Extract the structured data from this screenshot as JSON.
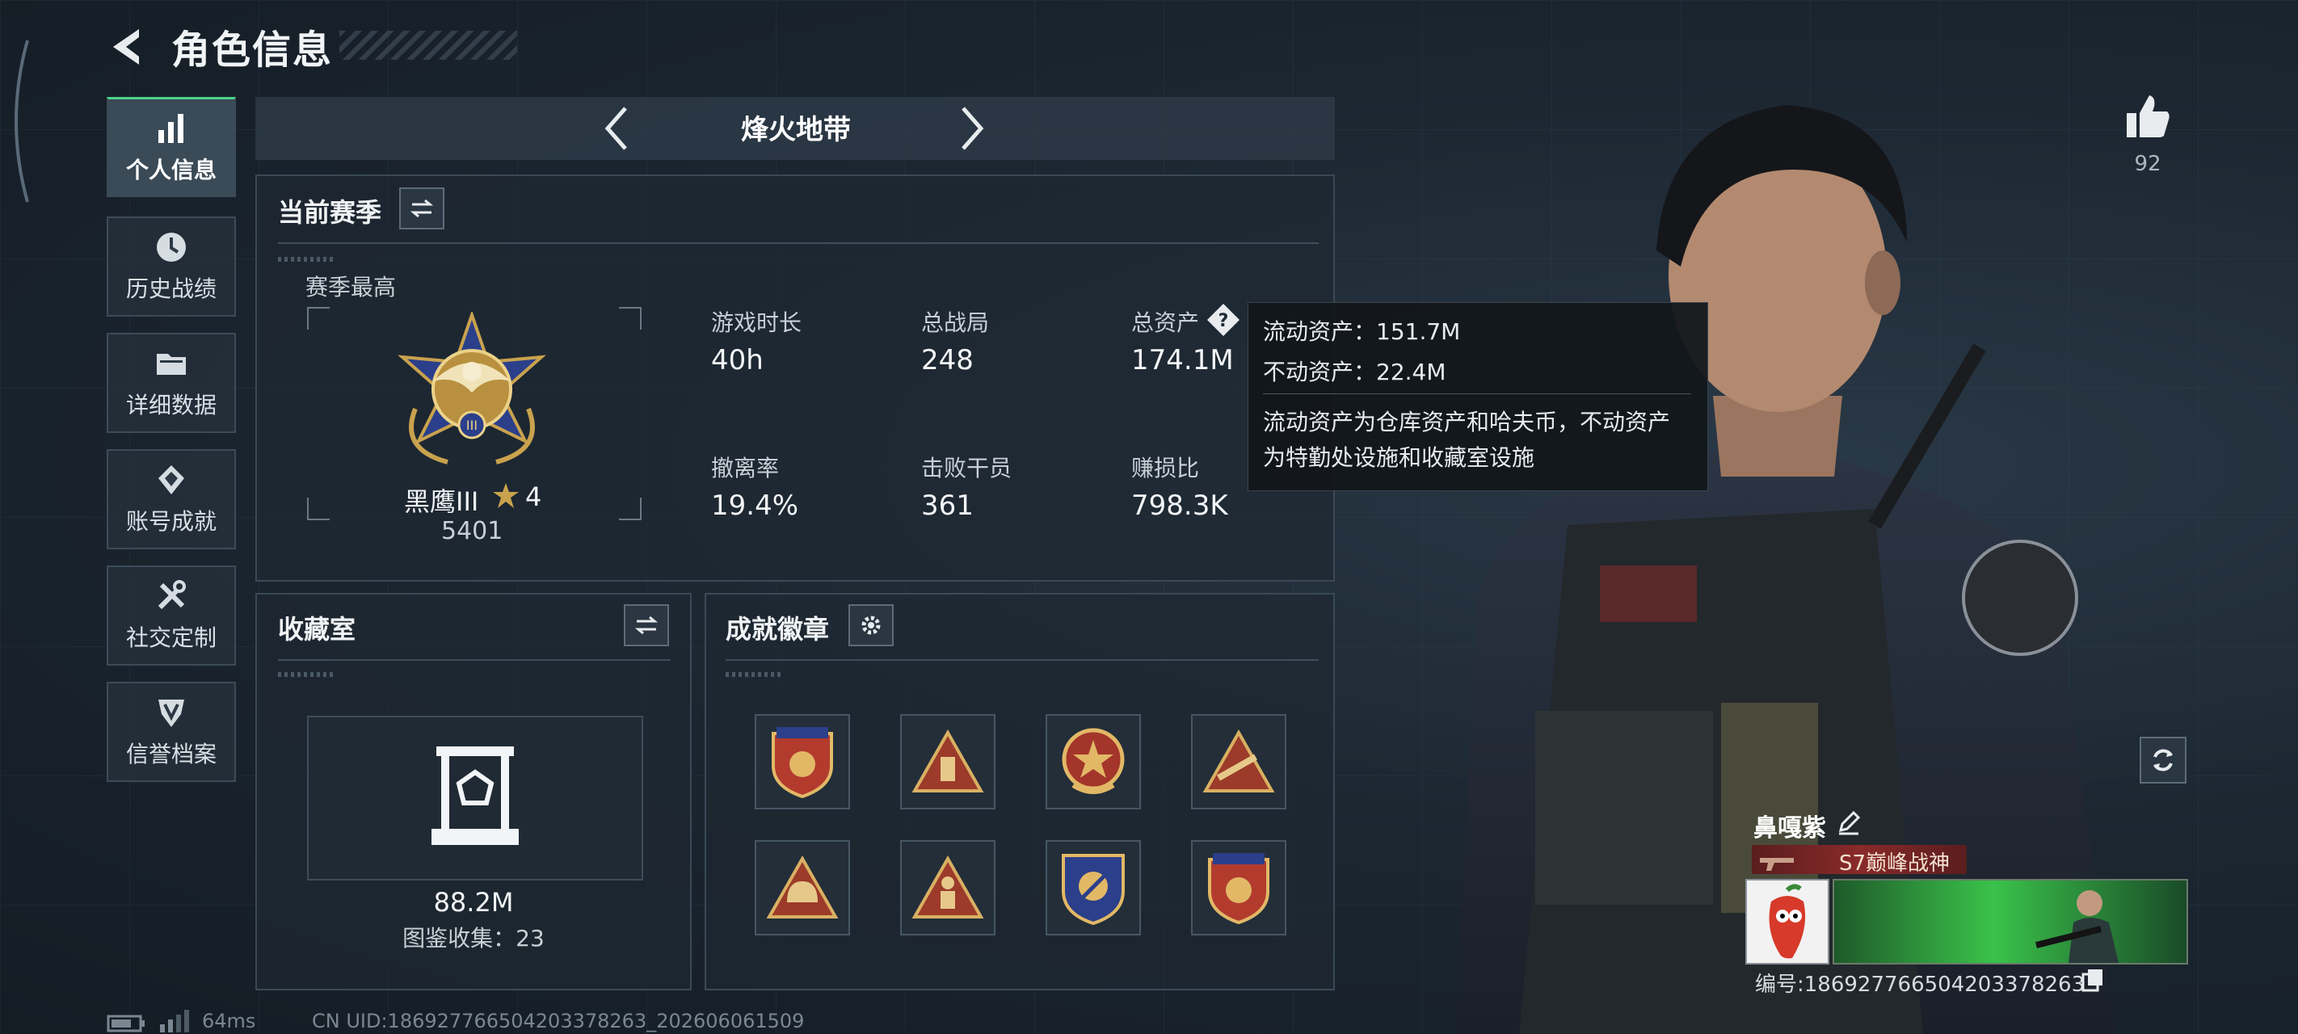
{
  "header": {
    "title": "角色信息"
  },
  "sidebar": {
    "items": [
      {
        "label": "个人信息",
        "icon": "bar-chart-icon",
        "active": true
      },
      {
        "label": "历史战绩",
        "icon": "clock-icon"
      },
      {
        "label": "详细数据",
        "icon": "folder-icon"
      },
      {
        "label": "账号成就",
        "icon": "achievement-icon"
      },
      {
        "label": "社交定制",
        "icon": "tools-icon"
      },
      {
        "label": "信誉档案",
        "icon": "shield-emblem-icon"
      }
    ]
  },
  "mode_tab": {
    "title": "烽火地带"
  },
  "season": {
    "panel_title": "当前赛季",
    "best_label": "赛季最高",
    "rank_name": "黑鹰III",
    "rank_stars": "4",
    "rank_score": "5401",
    "stats": [
      {
        "label": "游戏时长",
        "value": "40h"
      },
      {
        "label": "总战局",
        "value": "248"
      },
      {
        "label": "总资产",
        "value": "174.1M"
      },
      {
        "label": "撤离率",
        "value": "19.4%"
      },
      {
        "label": "击败干员",
        "value": "361"
      },
      {
        "label": "赚损比",
        "value": "798.3K"
      }
    ]
  },
  "tooltip": {
    "liquid": "流动资产：151.7M",
    "fixed": "不动资产：22.4M",
    "desc_line1": "流动资产为仓库资产和哈夫币，不动资产",
    "desc_line2": "为特勤处设施和收藏室设施"
  },
  "collection": {
    "panel_title": "收藏室",
    "value": "88.2M",
    "count_text": "图鉴收集：23"
  },
  "badges": {
    "panel_title": "成就徽章",
    "items": [
      "badge-red-shield-icon",
      "badge-tent-icon",
      "badge-star-medal-icon",
      "badge-rifle-icon",
      "badge-helmet-icon",
      "badge-soldier-icon",
      "badge-crest-icon",
      "badge-red-shield-2-icon"
    ]
  },
  "likes": {
    "count": "92"
  },
  "player": {
    "name": "鼻嘎紫",
    "title": "S7巅峰战神",
    "id_text": "编号:1869277665042033782​63"
  },
  "footer": {
    "ping": "64ms",
    "uid": "CN UID:18692776650420337826​3_202606061509"
  },
  "colors": {
    "accent_green": "#4cd38a",
    "panel": "#1e2832",
    "tooltip_bg": "#12161b"
  }
}
